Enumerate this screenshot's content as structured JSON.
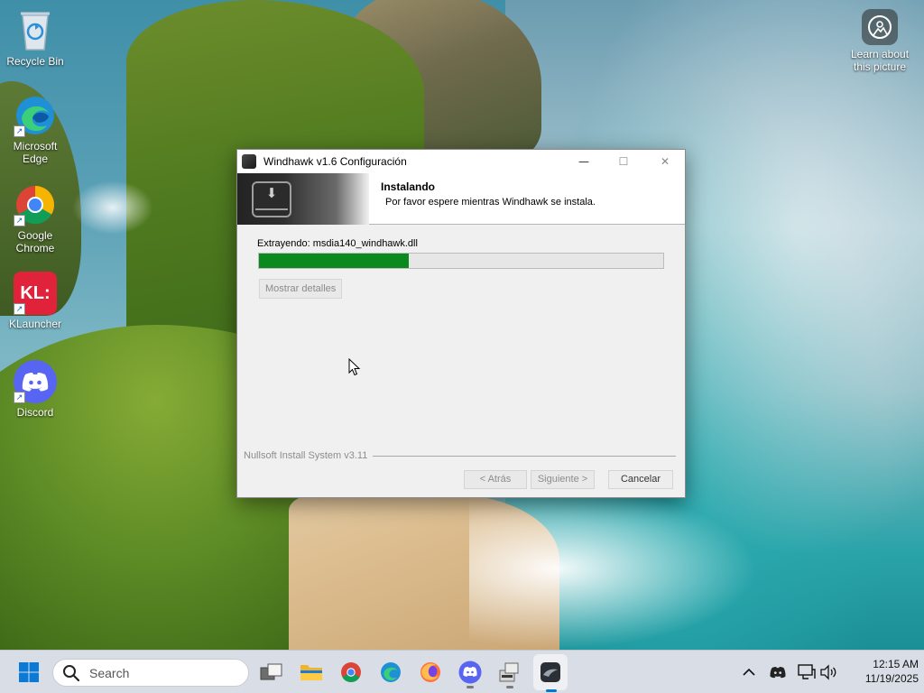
{
  "desktop": {
    "icons": [
      {
        "label_line1": "Recycle Bin",
        "label_line2": ""
      },
      {
        "label_line1": "Microsoft",
        "label_line2": "Edge"
      },
      {
        "label_line1": "Google",
        "label_line2": "Chrome"
      },
      {
        "label_line1": "KLauncher",
        "label_line2": ""
      },
      {
        "label_line1": "Discord",
        "label_line2": ""
      }
    ],
    "learn": {
      "line1": "Learn about",
      "line2": "this picture"
    }
  },
  "window": {
    "title": "Windhawk v1.6 Configuración",
    "header_title": "Instalando",
    "header_subtitle": "Por favor espere mientras Windhawk se instala.",
    "status_text": "Extrayendo: msdia140_windhawk.dll",
    "progress_fraction": 0.37,
    "details_button": "Mostrar detalles",
    "branding": "Nullsoft Install System v3.11",
    "buttons": {
      "back": "< Atrás",
      "next": "Siguiente >",
      "cancel": "Cancelar"
    },
    "minimize_glyph": "—",
    "maximize_glyph": "☐",
    "close_glyph": "✕"
  },
  "taskbar": {
    "search_placeholder": "Search",
    "pinned": [
      "task-view",
      "file-explorer",
      "chrome",
      "edge",
      "firefox",
      "discord",
      "installer",
      "windhawk"
    ],
    "time": "12:15 AM",
    "date": "11/19/2025"
  },
  "colors": {
    "progress_fill": "#0a8a1e",
    "taskbar_bg": "#d9dee6",
    "windows_blue": "#0078d4"
  }
}
